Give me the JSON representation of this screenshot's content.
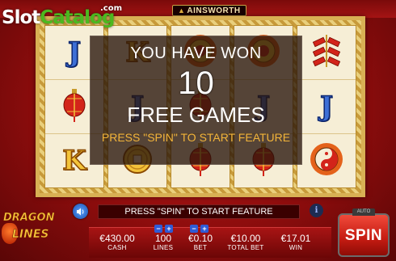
{
  "watermark": {
    "slot": "Slot",
    "catalog": "Catalog",
    "dotcom": ".com"
  },
  "provider": {
    "name": "AINSWORTH"
  },
  "reels": [
    [
      {
        "type": "letter",
        "text": "J",
        "color": "blue"
      },
      {
        "type": "icon",
        "icon": "lantern-icon"
      },
      {
        "type": "letter",
        "text": "K",
        "color": "gold"
      }
    ],
    [
      {
        "type": "letter",
        "text": "K",
        "color": "gold"
      },
      {
        "type": "letter",
        "text": "J",
        "color": "blue"
      },
      {
        "type": "icon",
        "icon": "coin-icon"
      }
    ],
    [
      {
        "type": "icon",
        "icon": "sun-medallion-icon"
      },
      {
        "type": "icon",
        "icon": "lantern-icon"
      },
      {
        "type": "icon",
        "icon": "lantern-icon"
      }
    ],
    [
      {
        "type": "icon",
        "icon": "sun-medallion-icon"
      },
      {
        "type": "letter",
        "text": "J",
        "color": "blue"
      },
      {
        "type": "icon",
        "icon": "lantern-icon"
      }
    ],
    [
      {
        "type": "icon",
        "icon": "firecracker-icon"
      },
      {
        "type": "letter",
        "text": "J",
        "color": "blue"
      },
      {
        "type": "icon",
        "icon": "yin-yang-icon"
      }
    ]
  ],
  "win_overlay": {
    "line1": "YOU HAVE WON",
    "count": "10",
    "line3": "FREE GAMES",
    "line4": "PRESS \"SPIN\" TO START FEATURE"
  },
  "message_bar": {
    "text": "PRESS \"SPIN\" TO START FEATURE"
  },
  "game_logo": {
    "line_a": "DRAGON",
    "line_b": "LINES"
  },
  "stats": {
    "cash": {
      "value": "€430.00",
      "label": "CASH"
    },
    "lines": {
      "value": "100",
      "label": "LINES"
    },
    "bet": {
      "value": "€0.10",
      "label": "BET"
    },
    "total_bet": {
      "value": "€10.00",
      "label": "TOTAL BET"
    },
    "win": {
      "value": "€17.01",
      "label": "WIN"
    }
  },
  "controls": {
    "spin_label": "SPIN",
    "auto_label": "AUTO",
    "minus": "−",
    "plus": "+",
    "info": "i"
  },
  "colors": {
    "accent_gold": "#f2b43a",
    "spin_red": "#e3271b",
    "frame_gold": "#d8b054"
  }
}
